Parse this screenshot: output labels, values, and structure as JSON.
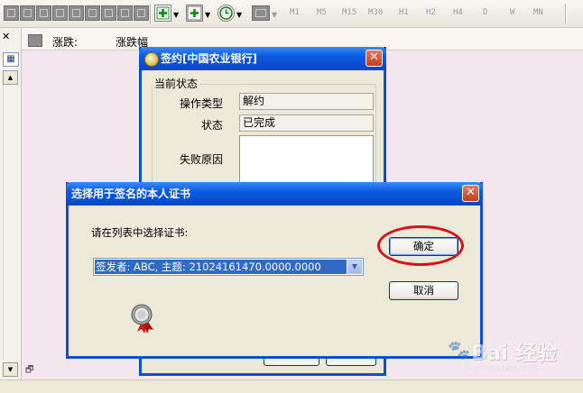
{
  "toolbar": {
    "periods": [
      "M1",
      "M5",
      "M15",
      "M30",
      "H1",
      "H2",
      "H4",
      "D",
      "W",
      "MN"
    ]
  },
  "quote_header": {
    "change_label": "涨跌:",
    "change_pct_label": "涨跌幅"
  },
  "sign_window": {
    "title": "签约[中国农业银行]",
    "group_label": "当前状态",
    "fields": [
      {
        "label": "操作类型",
        "value": "解约"
      },
      {
        "label": "状态",
        "value": "已完成"
      },
      {
        "label": "失败原因",
        "value": ""
      }
    ]
  },
  "cert_dialog": {
    "title": "选择用于签名的本人证书",
    "prompt": "请在列表中选择证书:",
    "selected_cert": "签发者: ABC, 主题: 21024161470.0000.0000",
    "ok_label": "确定",
    "cancel_label": "取消"
  },
  "watermark": {
    "main": "Bai 经验",
    "sub": "jingyan.baidu.com"
  },
  "colors": {
    "title_bar": "#0a5ae2",
    "selection": "#316ac5",
    "highlight_oval": "#d4141b",
    "dialog_bg": "#ece9d8"
  }
}
